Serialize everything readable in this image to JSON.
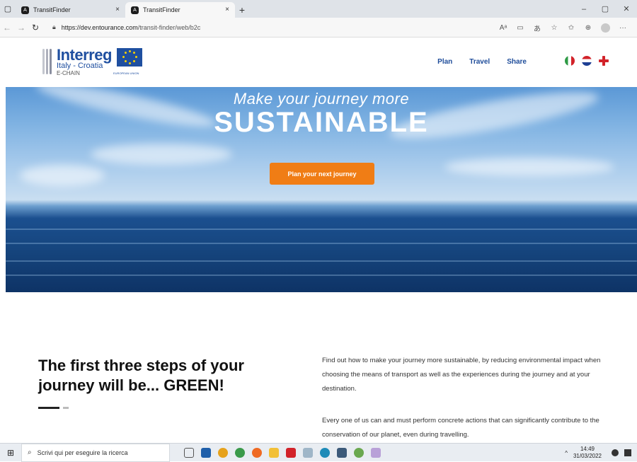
{
  "browser": {
    "tabs": [
      {
        "title": "TransitFinder"
      },
      {
        "title": "TransitFinder"
      }
    ],
    "tab_close": "×",
    "new_tab": "+",
    "window_controls": {
      "minimize": "–",
      "maximize": "▢",
      "close": "✕"
    },
    "url": {
      "host": "https://dev.entourance.com",
      "path": "/transit-finder/web/b2c"
    },
    "toolbar_icons": [
      "read-aloud-icon",
      "immersive-reader-icon",
      "translate-icon",
      "favorite-add-icon",
      "favorites-icon",
      "collections-icon",
      "profile-icon",
      "more-icon"
    ],
    "toolbar_glyphs": {
      "read": "Aᵃ",
      "reader": "▭",
      "translate": "あ",
      "fav_add": "☆",
      "favorites": "✩",
      "collections": "⊕",
      "more": "···"
    }
  },
  "site": {
    "logo": {
      "line1": "Interreg",
      "line2": "Italy - Croatia",
      "line3": "E-CHAIN",
      "eu_label": "EUROPEAN UNION"
    },
    "menu": [
      "Plan",
      "Travel",
      "Share"
    ],
    "flags": [
      "italian-flag-icon",
      "croatian-flag-icon",
      "english-flag-icon"
    ]
  },
  "hero": {
    "subtitle": "Make your journey more",
    "title": "SUSTAINABLE",
    "cta": "Plan your next journey"
  },
  "content": {
    "heading": "The first three steps of your journey will be... GREEN!",
    "paragraph1": "Find out how to make your journey more sustainable, by reducing environmental impact when choosing the means of transport as well as the experiences during the journey and at your destination.",
    "paragraph2": "Every one of us can and must perform concrete actions that can significantly contribute to the conservation of our planet, even during travelling."
  },
  "taskbar": {
    "search_placeholder": "Scrivi qui per eseguire la ricerca",
    "time": "14:49",
    "date": "31/03/2022",
    "tray_arrow": "^",
    "colors": {
      "accent": "#f07d15",
      "brand_blue": "#1e4c9a"
    }
  }
}
